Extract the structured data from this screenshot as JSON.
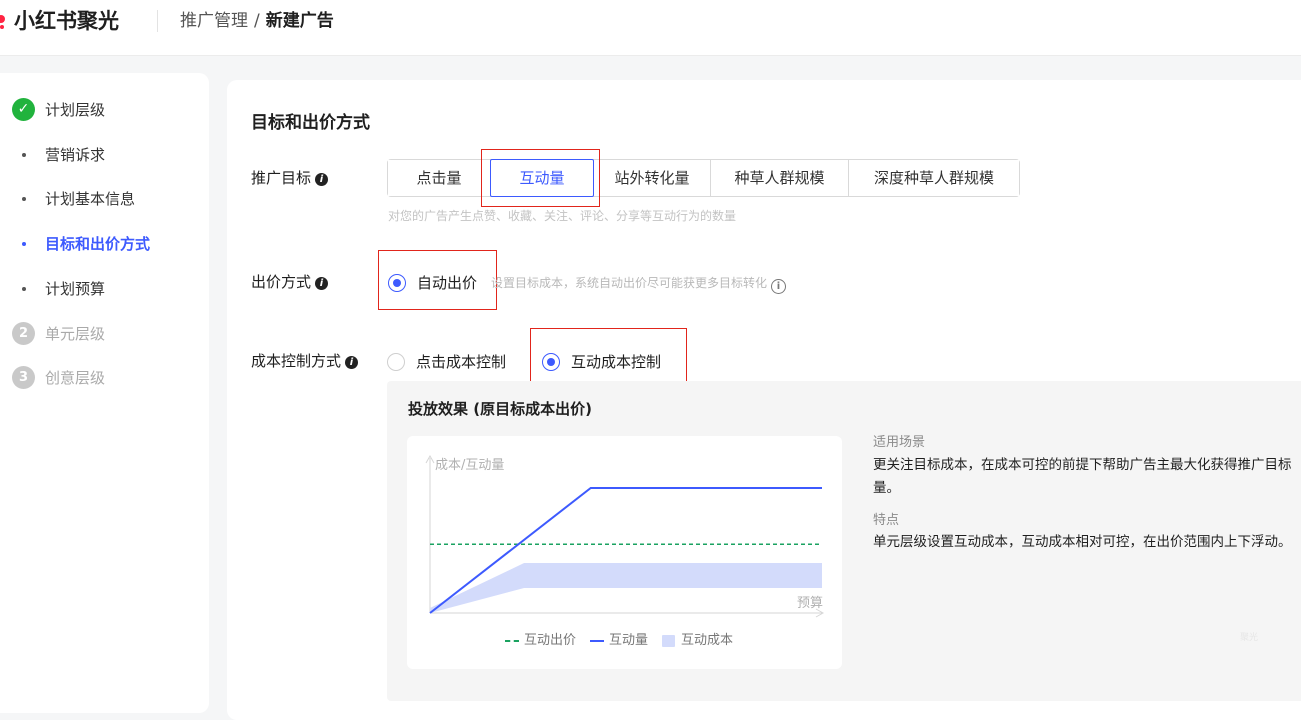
{
  "header": {
    "brand": "小红书聚光",
    "breadcrumb_parent": "推广管理",
    "breadcrumb_sep": "/",
    "breadcrumb_current": "新建广告"
  },
  "nav": {
    "items": [
      {
        "label": "计划层级",
        "state": "done"
      },
      {
        "label": "营销诉求",
        "state": "sub"
      },
      {
        "label": "计划基本信息",
        "state": "sub"
      },
      {
        "label": "目标和出价方式",
        "state": "active"
      },
      {
        "label": "计划预算",
        "state": "sub"
      },
      {
        "label": "单元层级",
        "state": "disabled",
        "step": "2"
      },
      {
        "label": "创意层级",
        "state": "disabled",
        "step": "3"
      }
    ]
  },
  "form": {
    "section_title": "目标和出价方式",
    "target_label": "推广目标",
    "targets": [
      {
        "label": "点击量",
        "selected": false
      },
      {
        "label": "互动量",
        "selected": true
      },
      {
        "label": "站外转化量",
        "selected": false
      },
      {
        "label": "种草人群规模",
        "selected": false
      },
      {
        "label": "深度种草人群规模",
        "selected": false
      }
    ],
    "target_hint": "对您的广告产生点赞、收藏、关注、评论、分享等互动行为的数量",
    "bid_label": "出价方式",
    "bid_option": "自动出价",
    "bid_hint": "设置目标成本，系统自动出价尽可能获更多目标转化",
    "cost_label": "成本控制方式",
    "cost_options": [
      {
        "label": "点击成本控制",
        "checked": false
      },
      {
        "label": "互动成本控制",
        "checked": true
      }
    ]
  },
  "effect": {
    "title": "投放效果 (原目标成本出价)",
    "scene_title": "适用场景",
    "scene_text": "更关注目标成本，在成本可控的前提下帮助广告主最大化获得推广目标量。",
    "feature_title": "特点",
    "feature_text": "单元层级设置互动成本，互动成本相对可控，在出价范围内上下浮动。",
    "watermark": "聚光"
  },
  "chart_data": {
    "type": "line",
    "ylabel": "成本/互动量",
    "xlabel": "预算",
    "series": [
      {
        "name": "互动出价",
        "style": "dashed",
        "color": "#1aa260",
        "x": [
          0,
          1
        ],
        "y": [
          0.55,
          0.55
        ]
      },
      {
        "name": "互动量",
        "style": "solid",
        "color": "#3d5afe",
        "x": [
          0,
          0.41,
          1
        ],
        "y": [
          0,
          1,
          1
        ]
      },
      {
        "name": "互动成本",
        "style": "area",
        "color": "#d3dbfb",
        "x": [
          0,
          0.24,
          1
        ],
        "y_low": [
          0,
          0.2,
          0.2
        ],
        "y_high": [
          0.04,
          0.4,
          0.4
        ]
      }
    ]
  }
}
